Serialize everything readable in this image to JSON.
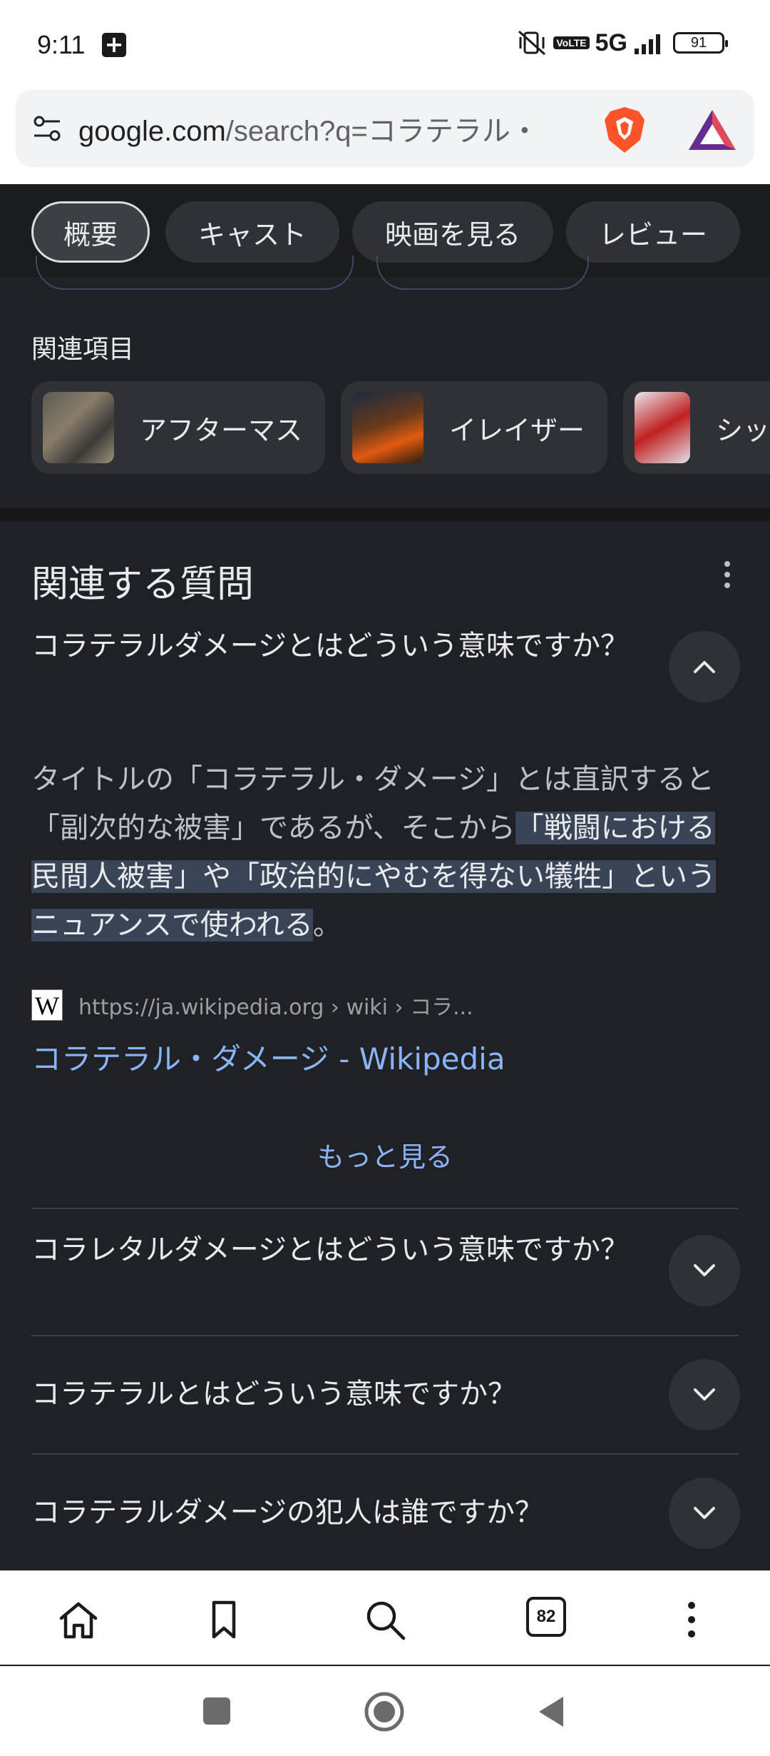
{
  "status_bar": {
    "time": "9:11",
    "network": "5G",
    "volte": "VoLTE",
    "battery": "91"
  },
  "address_bar": {
    "url_host": "google.com",
    "url_rest": "/search?q=コラテラル・"
  },
  "chips": [
    {
      "label": "概要",
      "active": true
    },
    {
      "label": "キャスト",
      "active": false
    },
    {
      "label": "映画を見る",
      "active": false
    },
    {
      "label": "レビュー",
      "active": false
    }
  ],
  "related": {
    "label": "関連項目",
    "items": [
      {
        "title": "アフターマス"
      },
      {
        "title": "イレイザー"
      },
      {
        "title": "シッ"
      }
    ]
  },
  "paa": {
    "title": "関連する質問",
    "expanded": {
      "question": "コラテラルダメージとはどういう意味ですか？",
      "answer_plain": "タイトルの「コラテラル・ダメージ」とは直訳すると「副次的な被害」であるが、そこから",
      "answer_highlight": "「戦闘における民間人被害」や「政治的にやむを得ない犠牲」というニュアンスで使われる",
      "answer_end": "。",
      "source_url": "https://ja.wikipedia.org › wiki › コラ...",
      "source_title": "コラテラル・ダメージ - Wikipedia",
      "more": "もっと見る"
    },
    "questions": [
      "コラレタルダメージとはどういう意味ですか？",
      "コラテラルとはどういう意味ですか？",
      "コラテラルダメージの犯人は誰ですか？"
    ]
  },
  "toolbar": {
    "tab_count": "82"
  },
  "colors": {
    "background": "#202124",
    "chip": "#303134",
    "link": "#8ab4f8",
    "highlight": "#394457"
  }
}
